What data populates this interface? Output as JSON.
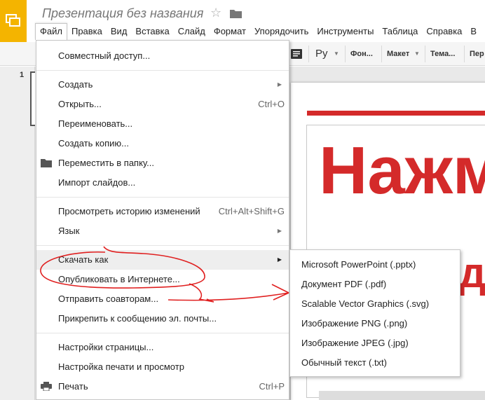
{
  "app": {
    "title": "Презентация без названия",
    "icons": {
      "logo": "slides-logo-icon",
      "star": "star-icon",
      "folder": "folder-icon"
    },
    "accent_color": "#f4b400"
  },
  "menubar": [
    {
      "label": "Файл",
      "active": true
    },
    {
      "label": "Правка"
    },
    {
      "label": "Вид"
    },
    {
      "label": "Вставка"
    },
    {
      "label": "Слайд"
    },
    {
      "label": "Формат"
    },
    {
      "label": "Упорядочить"
    },
    {
      "label": "Инструменты"
    },
    {
      "label": "Таблица"
    },
    {
      "label": "Справка"
    },
    {
      "label": "В"
    }
  ],
  "toolbar": {
    "language": "Ру",
    "background": "Фон...",
    "layout": "Макет",
    "theme": "Тема...",
    "transition": "Пер"
  },
  "filmstrip": {
    "slide_number": "1"
  },
  "slide": {
    "title_text": "Нажм",
    "body_text": "д",
    "accent_color": "#d42a2a"
  },
  "file_menu": {
    "items": [
      {
        "label": "Совместный доступ..."
      },
      {
        "label": "Создать",
        "submenu": true
      },
      {
        "label": "Открыть...",
        "shortcut": "Ctrl+O"
      },
      {
        "label": "Переименовать..."
      },
      {
        "label": "Создать копию..."
      },
      {
        "label": "Переместить в папку...",
        "icon": "folder-icon"
      },
      {
        "label": "Импорт слайдов..."
      },
      {
        "label": "Просмотреть историю изменений",
        "shortcut": "Ctrl+Alt+Shift+G"
      },
      {
        "label": "Язык",
        "submenu": true
      },
      {
        "label": "Скачать как",
        "submenu": true,
        "highlighted": true
      },
      {
        "label": "Опубликовать в Интернете..."
      },
      {
        "label": "Отправить соавторам..."
      },
      {
        "label": "Прикрепить к сообщению эл. почты..."
      },
      {
        "label": "Настройки страницы..."
      },
      {
        "label": "Настройка печати и просмотр"
      },
      {
        "label": "Печать",
        "shortcut": "Ctrl+P",
        "icon": "printer-icon"
      }
    ]
  },
  "download_submenu": {
    "items": [
      {
        "label": "Microsoft PowerPoint (.pptx)"
      },
      {
        "label": "Документ PDF (.pdf)"
      },
      {
        "label": "Scalable Vector Graphics (.svg)"
      },
      {
        "label": "Изображение PNG (.png)"
      },
      {
        "label": "Изображение JPEG (.jpg)"
      },
      {
        "label": "Обычный текст (.txt)"
      }
    ]
  },
  "annotation": {
    "color": "#e02020"
  }
}
